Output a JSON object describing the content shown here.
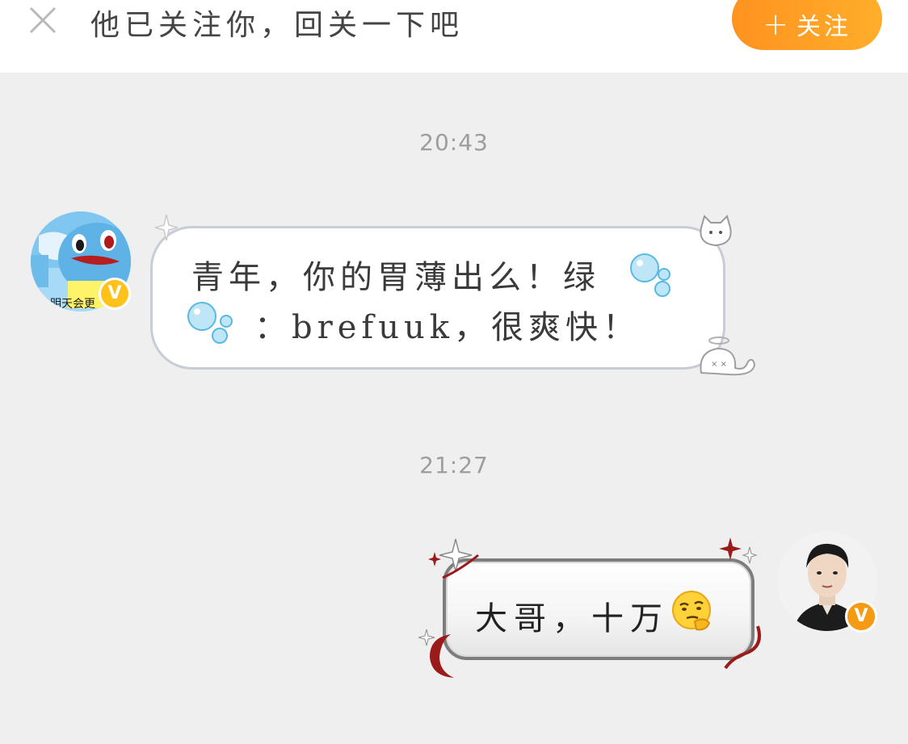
{
  "banner": {
    "text": "他已关注你，回关一下吧",
    "follow_label": "关注"
  },
  "messages": [
    {
      "time": "20:43",
      "direction": "incoming",
      "avatar_caption": "明天会更",
      "avatar_badge": "V",
      "line1": "青年，你的胃薄出么！绿",
      "line2": "：brefuuk，很爽快！"
    },
    {
      "time": "21:27",
      "direction": "outgoing",
      "avatar_badge": "V",
      "text": "大哥，十万"
    }
  ],
  "icons": {
    "close": "close-icon",
    "plus": "plus-icon",
    "bubble_emoji": "water-bubbles-emoji",
    "thinking_emoji": "thinking-face-emoji"
  },
  "colors": {
    "follow_button": "#ff9a22",
    "badge_orange": "#f59a14",
    "background": "#efefef"
  }
}
